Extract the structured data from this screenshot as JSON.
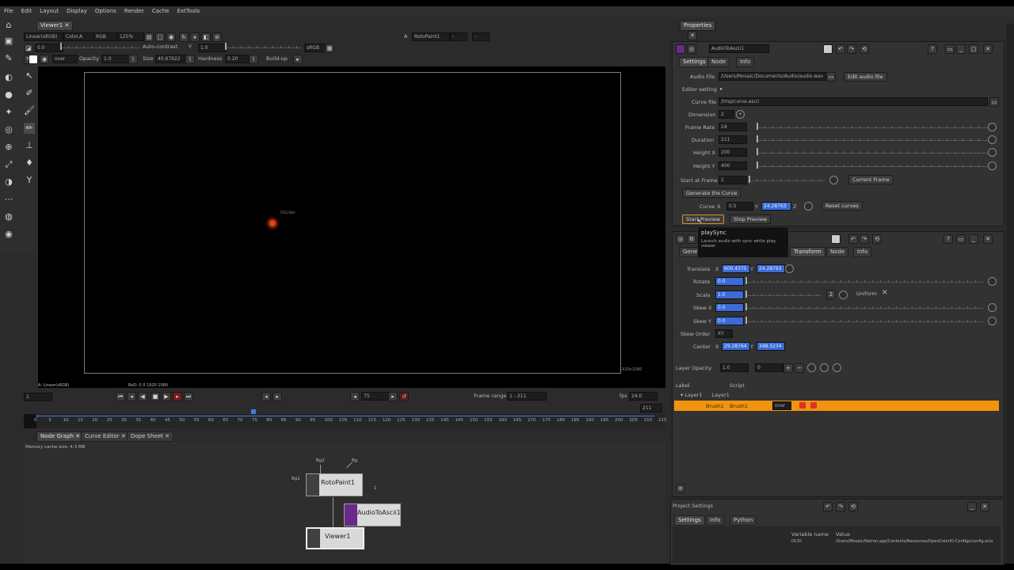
{
  "app": {
    "menu": [
      "File",
      "Edit",
      "Layout",
      "Display",
      "Options",
      "Render",
      "Cache",
      "ExtTools"
    ]
  },
  "viewer": {
    "tab_label": "Viewer1",
    "colorspace_label": "Linear(sRGB)",
    "layer_label": "Color.A",
    "channel_label": "RGB",
    "zoom_label": "125%",
    "gain_label": "Y",
    "gain_value": "1.0",
    "autocontrast_label": "Auto-contrast",
    "srgb_label": "sRGB",
    "node_select": "RotoPaint1",
    "opacity_label": "Opacity",
    "opacity_value": "1.0",
    "size_label": "Size",
    "size_value": "40.67922",
    "hardness_label": "Hardness",
    "hardness_value": "0.20",
    "buildup_label": "Build-up",
    "format_label": "HD 1920x1080",
    "readout_left": "A: Linear(sRGB)",
    "readout_mid": "RoD: 0 0 1920 1080",
    "point_label": "hSLider",
    "rod_label": "1920x1080",
    "small_label": "1920x1080"
  },
  "timeline": {
    "fps_label": "fps",
    "fps_value": "24.0",
    "frame_range_label": "Frame range",
    "frame_range_value": "1 - 211",
    "current_frame": "75",
    "frame_in": "1",
    "frame_out": "211",
    "ticks": [
      "0",
      "5",
      "10",
      "15",
      "20",
      "25",
      "30",
      "35",
      "40",
      "45",
      "50",
      "55",
      "60",
      "65",
      "70",
      "75",
      "80",
      "85",
      "90",
      "95",
      "100",
      "105",
      "110",
      "115",
      "120",
      "125",
      "130",
      "135",
      "140",
      "145",
      "150",
      "155",
      "160",
      "165",
      "170",
      "175",
      "180",
      "185",
      "190",
      "195",
      "200",
      "205",
      "210",
      "215"
    ]
  },
  "nodegraph": {
    "tabs": [
      "Node Graph",
      "Curve Editor",
      "Dope Sheet"
    ],
    "cache_info": "Memory cache size: 4.3 MB",
    "nodes": {
      "roto": "RotoPaint1",
      "audio": "AudioToAscii1",
      "viewer": "Viewer1"
    },
    "pins": {
      "bg": "Bg",
      "bg1": "Bg1",
      "bg2": "Bg2",
      "mask": "1"
    }
  },
  "properties": {
    "tab_label": "Properties",
    "node_name": "AudioToAscii1",
    "tabs": [
      "Settings",
      "Node",
      "Info"
    ],
    "audio_file_label": "Audio File",
    "audio_file_value": "/Users/Mosaic/Documents/Audio/audio.wav",
    "edit_audio_button": "Edit audio file",
    "editor_setting_label": "Editor setting",
    "curve_file_label": "Curve file",
    "curve_file_value": "/tmp/curve.ascii",
    "dimension_label": "Dimension",
    "dimension_value": "2",
    "frame_rate_label": "Frame Rate",
    "frame_rate_value": "24",
    "duration_label": "Duration",
    "duration_value": "211",
    "height_x_label": "Height X",
    "height_x_value": "200",
    "height_y_label": "Height Y",
    "height_y_value": "400",
    "start_frame_label": "Start at Frame",
    "start_frame_value": "1",
    "current_frame_button": "Current Frame",
    "generate_button": "Generate the Curve",
    "curve_label": "Curve",
    "curve_x_label": "X",
    "curve_x_value": "0.5",
    "curve_y_label": "Y",
    "curve_y_value": "24.28763",
    "curve_z_label": "Z",
    "reset_curves_button": "Reset curves",
    "start_preview_button": "Start Preview",
    "stop_preview_button": "Stop Preview"
  },
  "tooltip": {
    "title": "playSync",
    "body": "Launch audio with sync while play viewer"
  },
  "transform": {
    "tabs": [
      "General",
      "Transform",
      "Node",
      "Info"
    ],
    "translate_label": "Translate",
    "translate_x": "600.4375",
    "translate_y": "24.28763",
    "rotate_label": "Rotate",
    "rotate_value": "0.0",
    "scale_label": "Scale",
    "scale_value": "1.0",
    "uniform_label": "Uniform",
    "skewx_label": "Skew X",
    "skewx_value": "0.0",
    "skewy_label": "Skew Y",
    "skewy_value": "0.0",
    "skew_order_label": "Skew Order",
    "skew_order_value": "XY",
    "center_label": "Center",
    "center_x": "29.28764",
    "center_y": "348.5234",
    "layer_opacity_label": "Layer Opacity",
    "layer_opacity_value": "1.0",
    "layer_value2": "0",
    "layers_header": [
      "Label",
      "Script"
    ],
    "layer_row": {
      "name": "Layer1",
      "script": "Layer1"
    },
    "brush_row": {
      "name": "Brush1",
      "script": "Brush1",
      "mode": "over"
    }
  },
  "project": {
    "title": "Project Settings",
    "tabs": [
      "Settings",
      "Info",
      "Python"
    ],
    "table_header": [
      "Variable name",
      "Value"
    ],
    "row_name": "OCIO",
    "row_value": "/Users/Mosaic/Natron.app/Contents/Resources/OpenColorIO-Configs/config.ocio"
  }
}
